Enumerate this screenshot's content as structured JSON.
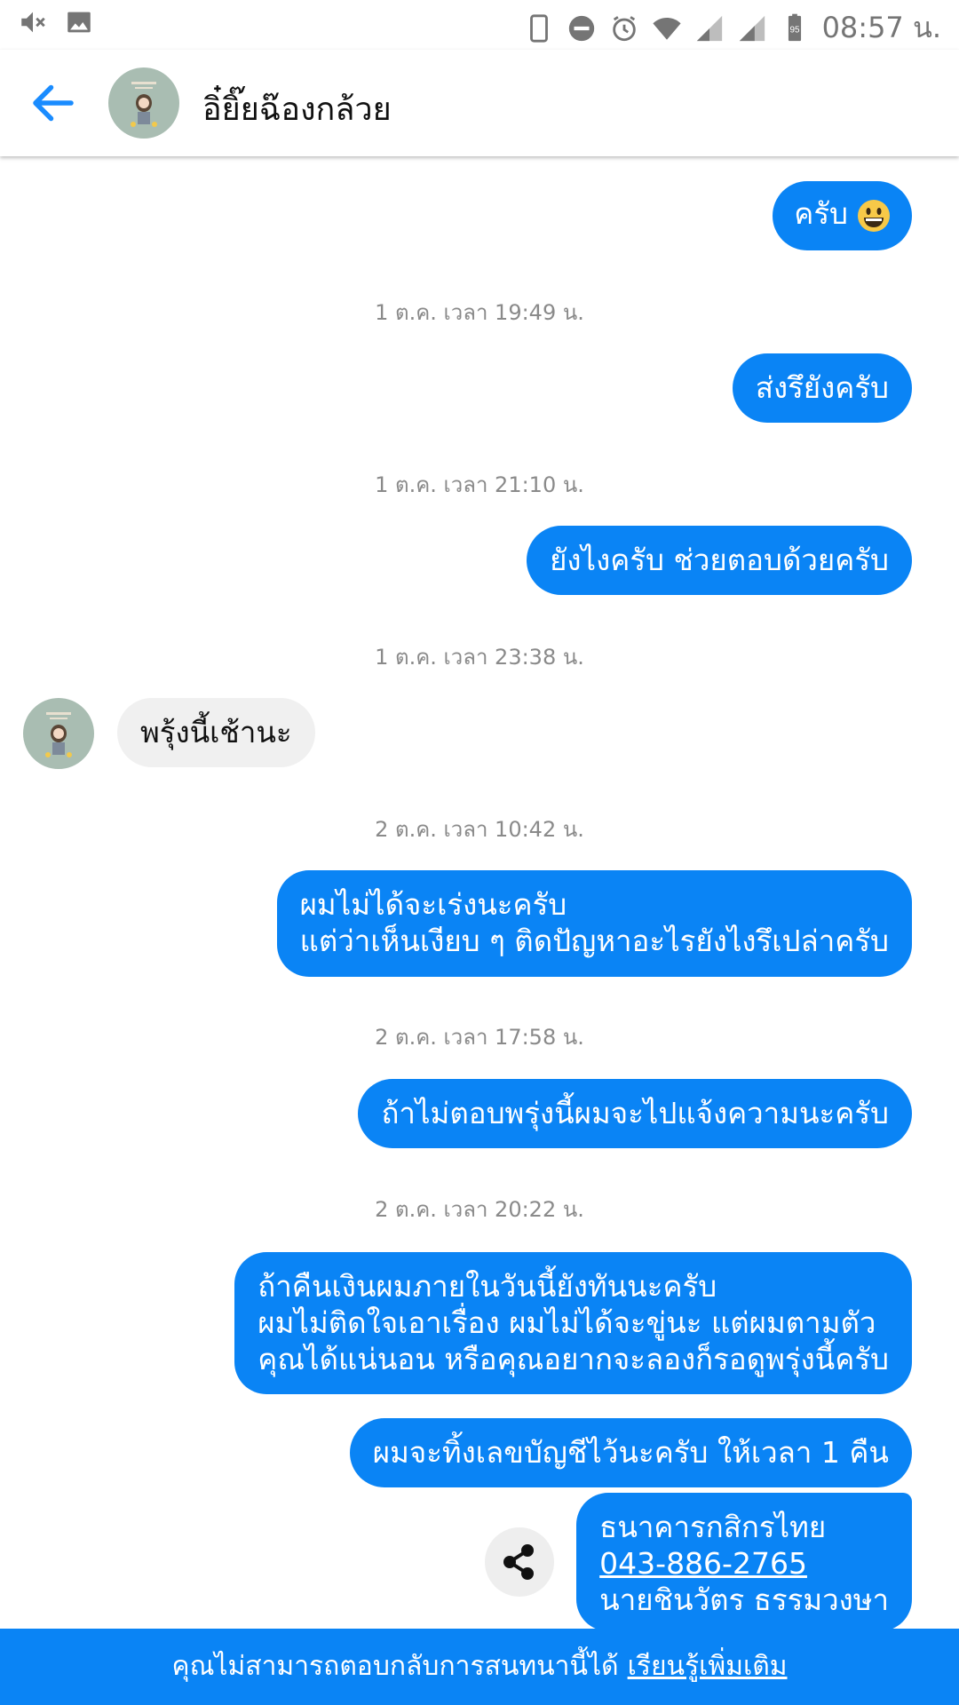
{
  "status_bar": {
    "time": "08:57 น.",
    "battery_level": "95",
    "icons": [
      "mute-icon",
      "gallery-icon",
      "phone-icon",
      "dnd-icon",
      "alarm-icon",
      "wifi-icon",
      "signal-icon",
      "signal-icon",
      "battery-icon"
    ]
  },
  "header": {
    "contact_name": "อิ๋ยิ๊ยฉ๊องกล้วย",
    "back_icon": "back-arrow-icon"
  },
  "messages": [
    {
      "type": "outgoing",
      "text": "ครับ",
      "emoji": "grinning-face"
    },
    {
      "type": "timestamp",
      "text": "1 ต.ค. เวลา 19:49 น."
    },
    {
      "type": "outgoing",
      "text": "ส่งรึยังครับ"
    },
    {
      "type": "timestamp",
      "text": "1 ต.ค. เวลา 21:10 น."
    },
    {
      "type": "outgoing",
      "text": "ยังไงครับ ช่วยตอบด้วยครับ"
    },
    {
      "type": "timestamp",
      "text": "1 ต.ค. เวลา 23:38 น."
    },
    {
      "type": "incoming",
      "text": "พรุ้งนี้เช้านะ"
    },
    {
      "type": "timestamp",
      "text": "2 ต.ค. เวลา 10:42 น."
    },
    {
      "type": "outgoing",
      "lines": [
        "ผมไม่ได้จะเร่งนะครับ",
        "แต่ว่าเห็นเงียบ ๆ ติดปัญหาอะไรยังไงรึเปล่าครับ"
      ]
    },
    {
      "type": "timestamp",
      "text": "2 ต.ค. เวลา 17:58 น."
    },
    {
      "type": "outgoing",
      "text": "ถ้าไม่ตอบพรุ่งนี้ผมจะไปแจ้งความนะครับ"
    },
    {
      "type": "timestamp",
      "text": "2 ต.ค. เวลา 20:22 น."
    },
    {
      "type": "outgoing",
      "lines": [
        "ถ้าคืนเงินผมภายในวันนี้ยังทันนะครับ",
        "ผมไม่ติดใจเอาเรื่อง ผมไม่ได้จะขู่นะ แต่ผมตามตัว",
        "คุณได้แน่นอน หรือคุณอยากจะลองก็รอดูพรุ่งนี้ครับ"
      ]
    },
    {
      "type": "outgoing",
      "text": "ผมจะทิ้งเลขบัญชีไว้นะครับ ให้เวลา 1 คืน"
    },
    {
      "type": "outgoing",
      "lines": [
        "ธนาคารกสิกรไทย",
        "043-886-2765",
        "นายชินวัตร ธรรมวงษา"
      ]
    }
  ],
  "footer": {
    "text": "คุณไม่สามารถตอบกลับการสนทนานี้ได้",
    "link": "เรียนรู้เพิ่มเติม"
  },
  "colors": {
    "accent": "#0a84f5",
    "incoming_bubble": "#f0f0f0",
    "timestamp": "#8a8a8a"
  }
}
